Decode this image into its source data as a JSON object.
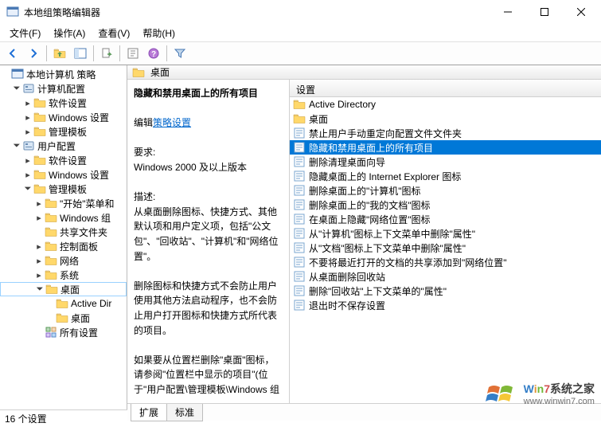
{
  "window": {
    "title": "本地组策略编辑器"
  },
  "menu": {
    "file": "文件(F)",
    "action": "操作(A)",
    "view": "查看(V)",
    "help": "帮助(H)"
  },
  "tree": {
    "root": "本地计算机 策略",
    "cc": "计算机配置",
    "cc_soft": "软件设置",
    "cc_win": "Windows 设置",
    "cc_admin": "管理模板",
    "uc": "用户配置",
    "uc_soft": "软件设置",
    "uc_win": "Windows 设置",
    "uc_admin": "管理模板",
    "start": "\"开始\"菜单和",
    "wincomp": "Windows 组",
    "shared": "共享文件夹",
    "cpanel": "控制面板",
    "network": "网络",
    "system": "系统",
    "desktop": "桌面",
    "ad": "Active Dir",
    "desk2": "桌面",
    "allset": "所有设置"
  },
  "header": {
    "title": "桌面"
  },
  "explain": {
    "title": "隐藏和禁用桌面上的所有项目",
    "edit_label": "编辑",
    "edit_link": "策略设置",
    "req_label": "要求:",
    "req_value": "Windows 2000 及以上版本",
    "desc_label": "描述:",
    "desc1": "从桌面删除图标、快捷方式、其他默认项和用户定义项，包括\"公文包\"、\"回收站\"、\"计算机\"和\"网络位置\"。",
    "desc2": "删除图标和快捷方式不会防止用户使用其他方法启动程序，也不会防止用户打开图标和快捷方式所代表的项目。",
    "desc3": "如果要从位置栏删除\"桌面\"图标，请参阅\"位置栏中显示的项目\"(位于\"用户配置\\管理模板\\Windows 组"
  },
  "list": {
    "col": "设置",
    "items": [
      "Active Directory",
      "桌面",
      "禁止用户手动重定向配置文件文件夹",
      "隐藏和禁用桌面上的所有项目",
      "删除清理桌面向导",
      "隐藏桌面上的 Internet Explorer 图标",
      "删除桌面上的\"计算机\"图标",
      "删除桌面上的\"我的文档\"图标",
      "在桌面上隐藏\"网络位置\"图标",
      "从\"计算机\"图标上下文菜单中删除\"属性\"",
      "从\"文档\"图标上下文菜单中删除\"属性\"",
      "不要将最近打开的文档的共享添加到\"网络位置\"",
      "从桌面删除回收站",
      "删除\"回收站\"上下文菜单的\"属性\"",
      "退出时不保存设置"
    ]
  },
  "tabs": {
    "extended": "扩展",
    "standard": "标准"
  },
  "status": {
    "text": "16 个设置"
  },
  "watermark": {
    "line1_parts": [
      "W",
      "i",
      "n",
      "7"
    ],
    "line1_suffix": "系统之家",
    "line2": "www.winwin7.com"
  }
}
